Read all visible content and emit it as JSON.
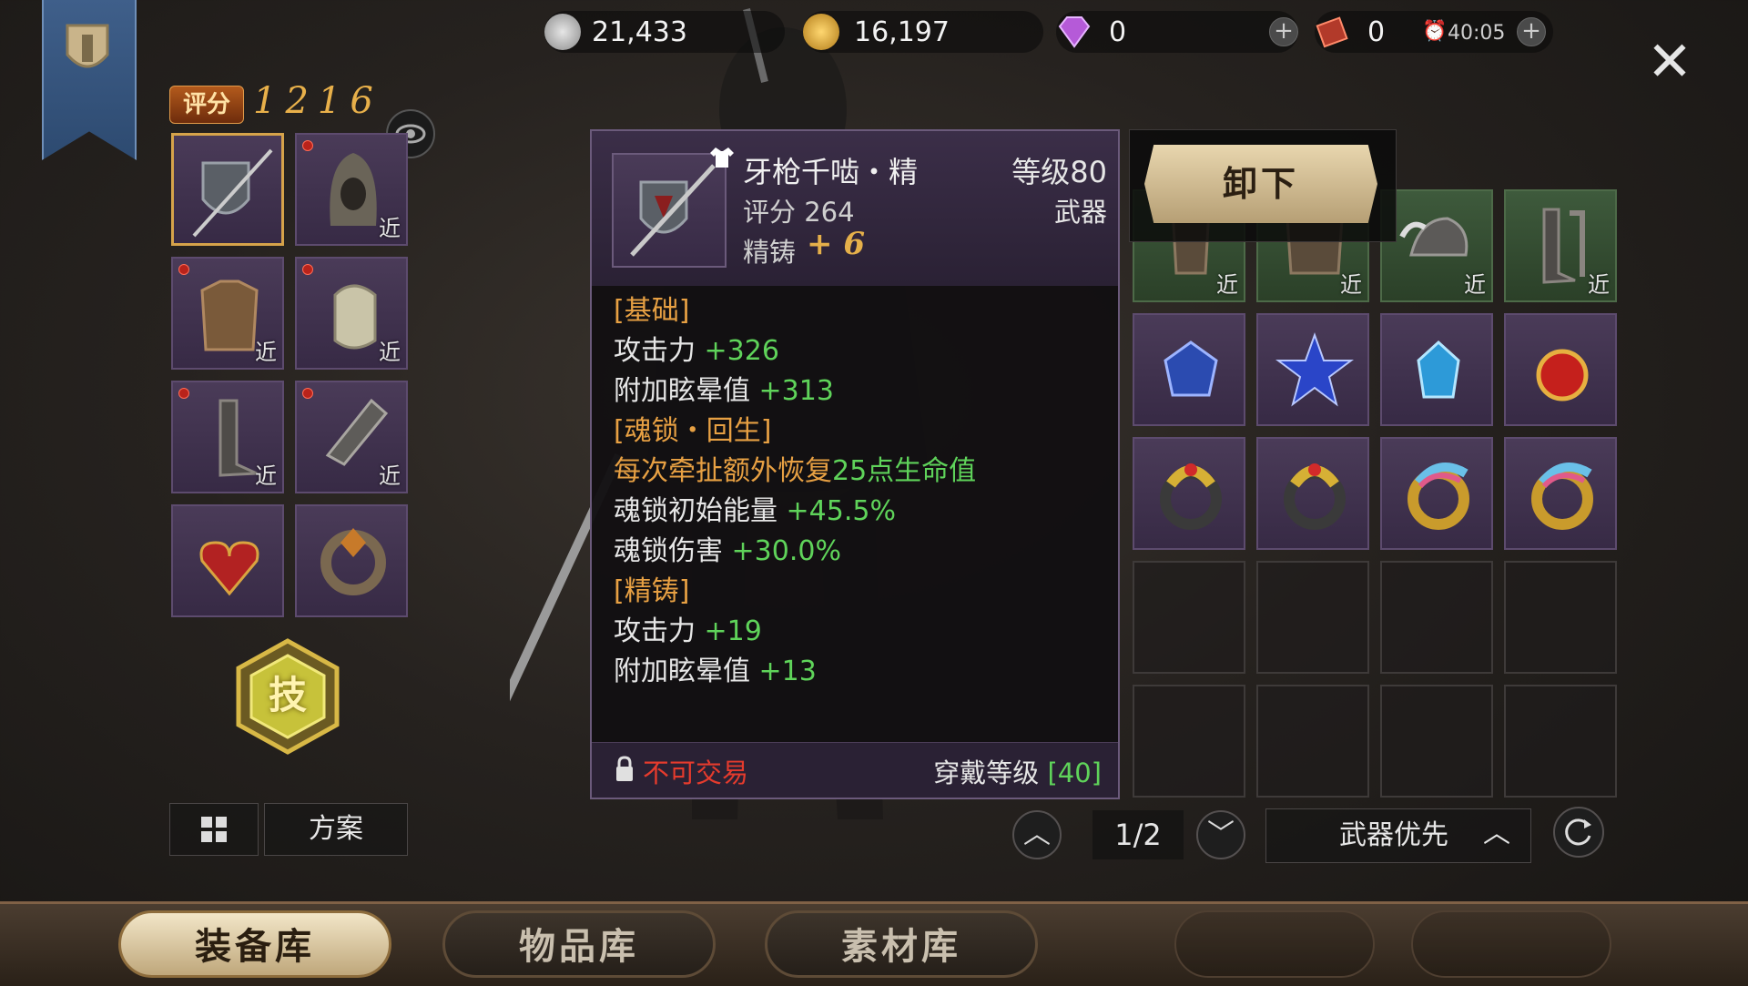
{
  "currency": {
    "silver": "21,433",
    "gold": "16,197",
    "diamond": "0",
    "ticket": "0",
    "timer": "40:05"
  },
  "score": {
    "badge": "评分",
    "value": "1216"
  },
  "equipped_slots": [
    {
      "icon": "spear-shield-icon",
      "near": "",
      "selected": true
    },
    {
      "icon": "hood-helmet-icon",
      "near": "近"
    },
    {
      "icon": "leather-vest-icon",
      "near": "近"
    },
    {
      "icon": "shoulder-guard-icon",
      "near": "近"
    },
    {
      "icon": "boots-icon",
      "near": "近"
    },
    {
      "icon": "gauntlet-icon",
      "near": "近"
    },
    {
      "icon": "heart-necklace-icon",
      "near": ""
    },
    {
      "icon": "ring-icon",
      "near": ""
    }
  ],
  "skill_label": "技",
  "plan_button": "方案",
  "tooltip": {
    "name": "牙枪千啮・精",
    "level": "等级80",
    "score": "评分 264",
    "type": "武器",
    "refine_label": "精铸",
    "refine_value": "+ 6",
    "sections": {
      "basic_title": "[基础]",
      "attack_label": "攻击力",
      "attack_value": "+326",
      "stun_label": "附加眩晕值",
      "stun_value": "+313",
      "soul_title": "[魂锁・回生]",
      "soul_desc_a": "每次牵扯额外恢复",
      "soul_desc_b": "25点生命值",
      "soul_energy_label": "魂锁初始能量",
      "soul_energy_value": "+45.5%",
      "soul_damage_label": "魂锁伤害",
      "soul_damage_value": "+30.0%",
      "refine_title": "[精铸]",
      "refine_attack_label": "攻击力",
      "refine_attack_value": "+19",
      "refine_stun_label": "附加眩晕值",
      "refine_stun_value": "+13"
    },
    "untradeable": "不可交易",
    "wear_label": "穿戴等级",
    "wear_value": "[40]"
  },
  "unequip_button": "卸下",
  "inventory_rows": [
    [
      {
        "icon": "leg-armor-icon",
        "near": "近"
      },
      {
        "icon": "chest-armor-icon",
        "near": "近"
      },
      {
        "icon": "horned-helmet-icon",
        "near": "近"
      },
      {
        "icon": "greaves-icon",
        "near": "近"
      }
    ],
    [
      {
        "icon": "sapphire-amulet-icon"
      },
      {
        "icon": "star-amulet-icon"
      },
      {
        "icon": "crystal-pendant-icon"
      },
      {
        "icon": "ruby-pendant-icon"
      }
    ],
    [
      {
        "icon": "gold-ring-red-icon"
      },
      {
        "icon": "gold-ring-red-icon"
      },
      {
        "icon": "rainbow-ring-icon"
      },
      {
        "icon": "rainbow-ring-icon"
      }
    ]
  ],
  "pager": {
    "text": "1/2"
  },
  "sort": {
    "label": "武器优先"
  },
  "tabs": [
    "装备库",
    "物品库",
    "素材库"
  ],
  "colors": {
    "accent_gold": "#e5b04a",
    "stat_green": "#5fd35a",
    "warn_red": "#e53b2d",
    "slot_purple": "#4a3b58"
  }
}
